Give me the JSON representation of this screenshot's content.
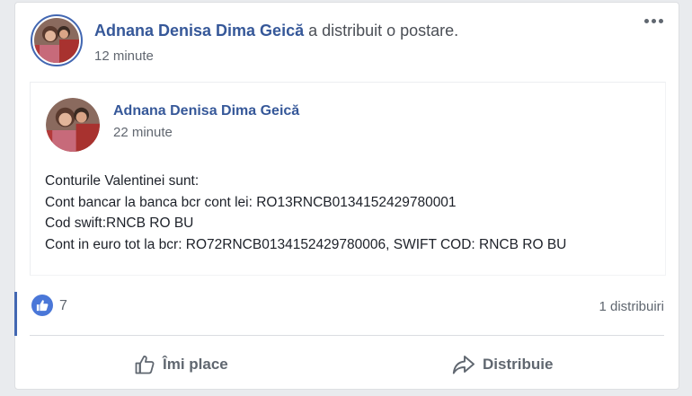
{
  "header": {
    "author": "Adnana Denisa Dima Geică",
    "action": " a distribuit o postare.",
    "time": "12 minute"
  },
  "shared_post": {
    "author": "Adnana Denisa Dima Geică",
    "time": "22 minute",
    "lines": [
      "Conturile Valentinei sunt:",
      "Cont bancar la banca bcr cont lei: RO13RNCB0134152429780001",
      "Cod swift:RNCB RO BU",
      "Cont in euro tot la bcr: RO72RNCB0134152429780006, SWIFT COD: RNCB RO BU"
    ]
  },
  "reactions": {
    "like_count": "7",
    "shares": "1 distribuiri"
  },
  "actions": {
    "like_label": "Îmi place",
    "share_label": "Distribuie"
  },
  "icons": {
    "more": "more-options-icon",
    "like_badge": "thumbs-up-icon",
    "like": "thumbs-up-outline-icon",
    "share": "share-arrow-icon"
  },
  "colors": {
    "link": "#365899",
    "accent": "#4267b2",
    "like_badge": "#4a77d8",
    "muted": "#606770"
  }
}
